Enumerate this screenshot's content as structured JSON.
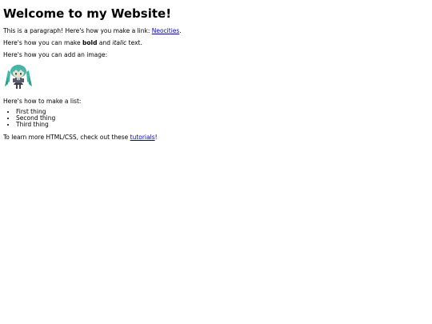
{
  "heading": "Welcome to my Website!",
  "para1": {
    "text_before": "This is a paragraph! Here's how you make a link: ",
    "link": "Neocities",
    "text_after": "."
  },
  "para2": {
    "text_before": "Here's how you can make ",
    "bold": "bold",
    "middle": " and ",
    "italic": "italic",
    "text_after": " text."
  },
  "para3": "Here's how you can add an image:",
  "image": {
    "icon": "chibi-character-sprite",
    "colors": {
      "hair": "#3fb8a8",
      "outfit": "#5a5a6a",
      "skin": "#f6dcc8"
    }
  },
  "para4": "Here's how to make a list:",
  "list_items": [
    "First thing",
    "Second thing",
    "Third thing"
  ],
  "para5": {
    "text_before": "To learn more HTML/CSS, check out these ",
    "link": "tutorials",
    "text_after": "!"
  }
}
